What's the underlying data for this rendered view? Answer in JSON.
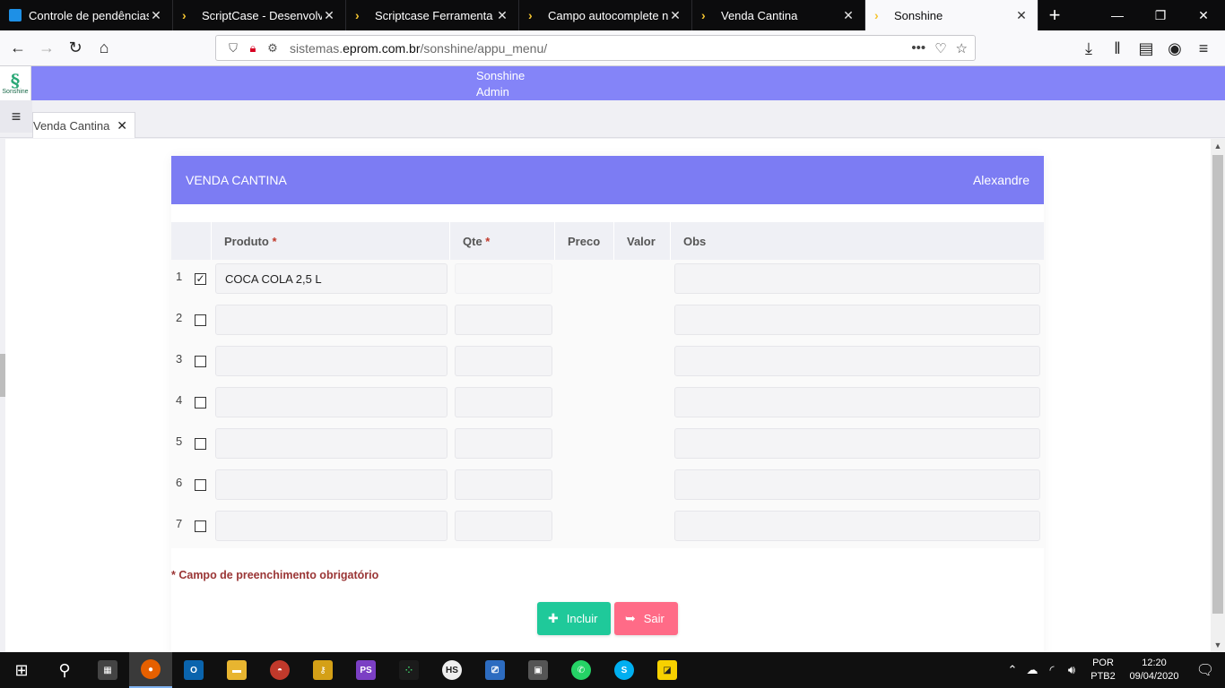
{
  "browser": {
    "tabs": [
      {
        "title": "Controle de pendências | ",
        "icon": "doc-icon"
      },
      {
        "title": "ScriptCase - Desenvolvim",
        "icon": "scriptcase-icon"
      },
      {
        "title": "Scriptcase Ferramenta de",
        "icon": "scriptcase-icon"
      },
      {
        "title": "Campo autocomplete na",
        "icon": "scriptcase-icon"
      },
      {
        "title": "Venda Cantina",
        "icon": "scriptcase-icon"
      },
      {
        "title": "Sonshine",
        "icon": "scriptcase-icon",
        "active": true
      }
    ],
    "url_prefix": "sistemas.",
    "url_domain": "eprom.com.br",
    "url_path": "/sonshine/appu_menu/"
  },
  "app": {
    "logo_text": "Sonshine",
    "user_line1": "Sonshine",
    "user_line2": "Admin",
    "tab_label": "Venda Cantina"
  },
  "form": {
    "title": "VENDA CANTINA",
    "user": "Alexandre",
    "columns": {
      "produto": "Produto",
      "qte": "Qte",
      "required_mark": "*",
      "preco": "Preco",
      "valor": "Valor",
      "obs": "Obs"
    },
    "rows": [
      {
        "num": "1",
        "checked": true,
        "produto": "COCA COLA 2,5 L",
        "qte": "",
        "obs": ""
      },
      {
        "num": "2",
        "checked": false,
        "produto": "",
        "qte": "",
        "obs": ""
      },
      {
        "num": "3",
        "checked": false,
        "produto": "",
        "qte": "",
        "obs": ""
      },
      {
        "num": "4",
        "checked": false,
        "produto": "",
        "qte": "",
        "obs": ""
      },
      {
        "num": "5",
        "checked": false,
        "produto": "",
        "qte": "",
        "obs": ""
      },
      {
        "num": "6",
        "checked": false,
        "produto": "",
        "qte": "",
        "obs": ""
      },
      {
        "num": "7",
        "checked": false,
        "produto": "",
        "qte": "",
        "obs": ""
      }
    ],
    "required_note": "* Campo de preenchimento obrigatório",
    "incluir_label": "Incluir",
    "sair_label": "Sair"
  },
  "taskbar": {
    "lang_line1": "POR",
    "lang_line2": "PTB2",
    "time": "12:20",
    "date": "09/04/2020"
  },
  "colors": {
    "header": "#8484f8",
    "form_title": "#7c7cf3",
    "incluir": "#1fc99a",
    "sair": "#ff6b87"
  }
}
